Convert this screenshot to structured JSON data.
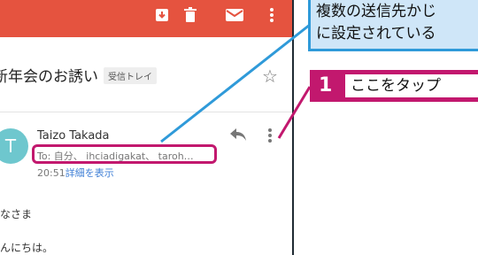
{
  "toolbar": {
    "icons": [
      "archive-icon",
      "delete-icon",
      "mail-icon",
      "more-vert-icon"
    ]
  },
  "email": {
    "subject": "新年会のお誘い",
    "label": "受信トレイ",
    "sender_initial": "T",
    "sender_name": "Taizo Takada",
    "to_line": "To: 自分、 ihciadigakat、 taroh…",
    "time": "20:51",
    "details_link": "詳細を表示",
    "body_line1": "なさま",
    "body_line2": "んにちは。"
  },
  "annotations": {
    "callout_line1": "複数の送信先かじ",
    "callout_line2": "に設定されている",
    "step_number": "1",
    "step_text": "ここをタップ"
  },
  "colors": {
    "toolbar": "#e5533f",
    "highlight": "#c2186e",
    "callout_border": "#2f9ad9",
    "callout_fill": "#cfe6f8",
    "avatar": "#6ec7ce",
    "link": "#3f7fd6"
  }
}
